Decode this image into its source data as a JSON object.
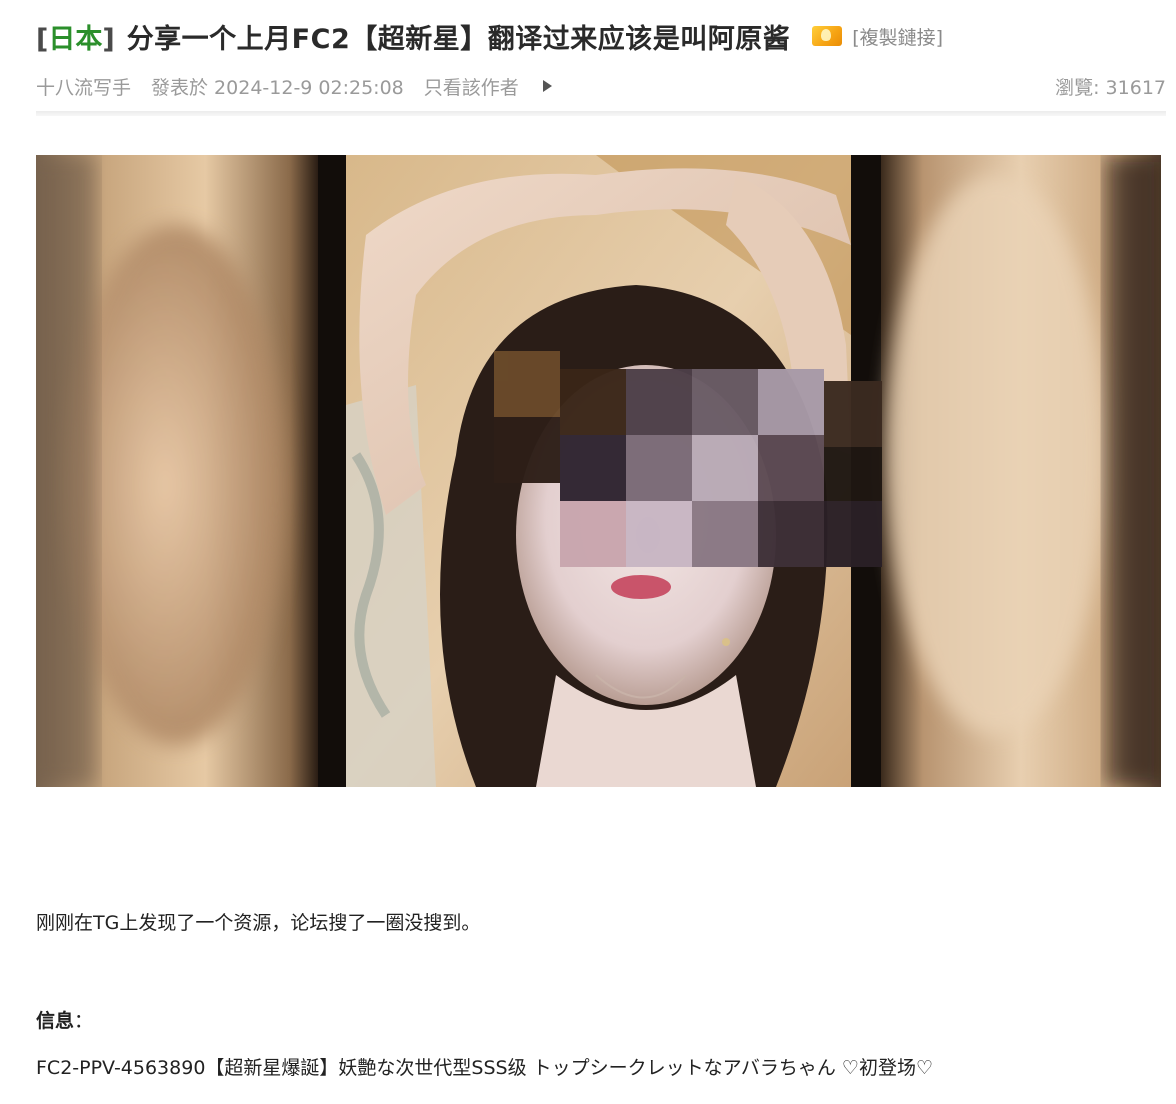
{
  "thread": {
    "forum_bracket_open": "[",
    "forum_name": "日本",
    "forum_bracket_close": "]",
    "title": "分享一个上月FC2【超新星】翻译过来应该是叫阿原酱",
    "hot_icon": "fire-icon",
    "copy_link_label": "[複製鏈接]"
  },
  "meta": {
    "author": "十八流写手",
    "posted": "發表於 2024-12-9 02:25:08",
    "only_author_label": "只看該作者",
    "play_icon": "play-arrow-icon",
    "views": "瀏覽:  31617"
  },
  "post": {
    "image_description_icon": "photo-icon",
    "line1": "刚刚在TG上发现了一个资源，论坛搜了一圈没搜到。",
    "info_label": "信息",
    "info_colon": "：",
    "info_text": "FC2-PPV-4563890【超新星爆誕】妖艶な次世代型SSS级 トップシークレットなアバラちゃん ♡初登场♡"
  },
  "colors": {
    "forum_name": "#2b8f2b",
    "title": "#2a2a2a",
    "meta": "#9a9a9a",
    "body": "#222222"
  }
}
